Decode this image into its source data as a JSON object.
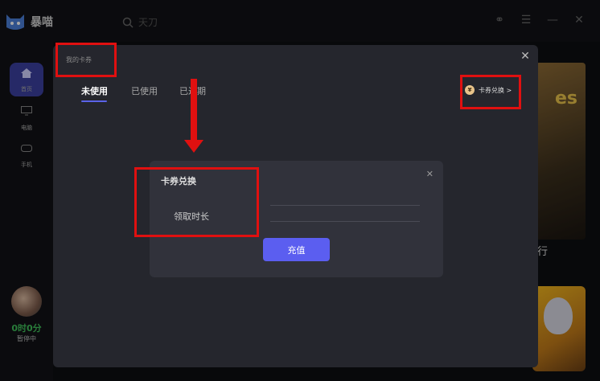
{
  "app": {
    "name": "暴喵",
    "search_placeholder": "天刀"
  },
  "sidebar": {
    "items": [
      {
        "label": "首页"
      },
      {
        "label": "电脑"
      },
      {
        "label": "手机"
      }
    ],
    "user": {
      "time": "0时0分",
      "status": "暂停中"
    }
  },
  "background": {
    "row_label": "行",
    "card_title": "es"
  },
  "coupon_dialog": {
    "title": "我的卡券",
    "tabs": [
      {
        "label": "未使用"
      },
      {
        "label": "已使用"
      },
      {
        "label": "已过期"
      }
    ],
    "redeem_link": "卡券兑换 >"
  },
  "redeem_dialog": {
    "title": "卡券兑换",
    "field_label": "领取时长",
    "button": "充值"
  },
  "colors": {
    "accent": "#5b5ef0",
    "annotation": "#e01010",
    "timer": "#3fbf5a"
  }
}
